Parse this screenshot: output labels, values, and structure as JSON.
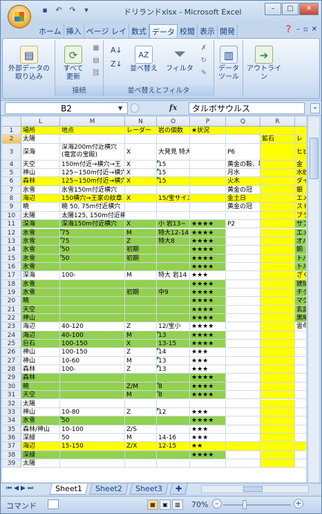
{
  "window": {
    "title": "ドリランドxlsx - Microsoft Excel"
  },
  "tabs": [
    "ホーム",
    "挿入",
    "ページ レイ",
    "数式",
    "データ",
    "校閲",
    "表示",
    "開発"
  ],
  "active_tab": "データ",
  "ribbon": {
    "external_data": "外部データの\n取り込み",
    "refresh_all": "すべて\n更新",
    "connections_group": "接続",
    "sort": "並べ替え",
    "filter": "フィルタ",
    "sort_filter_group": "並べ替えとフィルタ",
    "data_tools": "データ\nツール",
    "outline": "アウトライン"
  },
  "formula_bar": {
    "name_box": "B2",
    "fx": "fx",
    "formula": "タルボサウルス"
  },
  "columns": [
    "L",
    "M",
    "N",
    "O",
    "P",
    "Q",
    "R"
  ],
  "sheets": [
    "Sheet1",
    "Sheet2",
    "Sheet3"
  ],
  "status": {
    "mode": "コマンド",
    "zoom": "70%"
  },
  "rows": [
    {
      "n": "1",
      "L": "場所",
      "M": "地点",
      "N": "レーダー",
      "O": "岩の個数",
      "P": "★状況",
      "Q": "",
      "R": "",
      "S": "",
      "fill": "y"
    },
    {
      "n": "2",
      "L": "太陽",
      "M": "",
      "N": "",
      "O": "",
      "P": "",
      "Q": "",
      "R": "鉱石",
      "S": "レ"
    },
    {
      "n": "3",
      "L": "深海",
      "M": "深海200m付近横穴\n(竜宮の宝殿)",
      "N": "X",
      "O": "大発見 特大 岩16~",
      "P": "",
      "Q": "P6",
      "R": "",
      "S": "ヒビ"
    },
    {
      "n": "4",
      "L": "天空",
      "M": "150m付近→横穴→王",
      "N": "X",
      "O": "15",
      "P": "",
      "Q": "黄金の鞍、靴、耳飾り",
      "R": "",
      "S": "金",
      "tri": [
        "O"
      ]
    },
    {
      "n": "5",
      "L": "神山",
      "M": "125~150m付近→横穴",
      "N": "X",
      "O": "15",
      "P": "",
      "Q": "月水",
      "R": "",
      "S": "水紋",
      "tri": [
        "O"
      ]
    },
    {
      "n": "6",
      "L": "森林",
      "M": "125~150m付近→横穴",
      "N": "X",
      "O": "15",
      "P": "",
      "Q": "火木",
      "R": "",
      "S": "ダイ",
      "fill": "y",
      "tri": [
        "O"
      ]
    },
    {
      "n": "7",
      "L": "氷雪",
      "M": "氷雪150m付近横穴",
      "N": "",
      "O": "",
      "P": "",
      "Q": "黄金の冠",
      "R": "",
      "S": "銀"
    },
    {
      "n": "8",
      "L": "海辺",
      "M": "150横穴→王家の紋章",
      "N": "X",
      "O": "15/宝サイズ極小",
      "P": "",
      "Q": "金土日",
      "R": "",
      "S": "エメ",
      "fill": "y"
    },
    {
      "n": "9",
      "L": "暁",
      "M": "暁 50, 75m付近横穴",
      "N": "",
      "O": "",
      "P": "",
      "Q": "黄金の冠",
      "R": "",
      "S": "スト"
    },
    {
      "n": "10",
      "L": "太陽",
      "M": "太陽125, 150m付近横穴",
      "N": "",
      "O": "",
      "P": "",
      "Q": "",
      "R": "",
      "S": "ブラ"
    },
    {
      "n": "11",
      "L": "深海",
      "M": "深海150m付近横穴",
      "N": "X",
      "O": "小 岩13~",
      "P": "★★★★",
      "Q": "P2",
      "R": "",
      "S": "サフ",
      "fill": "g"
    },
    {
      "n": "12",
      "L": "氷雪",
      "M": "75",
      "N": "M",
      "O": "特大12-14",
      "P": "★★★★",
      "Q": "",
      "R": "",
      "S": "エメ",
      "fill": "g",
      "tri": [
        "M"
      ]
    },
    {
      "n": "13",
      "L": "氷雪",
      "M": "75",
      "N": "Z",
      "O": "特大8",
      "P": "★★★★",
      "Q": "",
      "R": "",
      "S": "オパ",
      "fill": "g",
      "tri": [
        "M"
      ]
    },
    {
      "n": "14",
      "L": "氷雪",
      "M": "50",
      "N": "初期",
      "O": "",
      "P": "★★★★",
      "Q": "",
      "R": "",
      "S": "銅",
      "fill": "g",
      "tri": [
        "M"
      ]
    },
    {
      "n": "15",
      "L": "氷雪",
      "M": "50",
      "N": "初期",
      "O": "",
      "P": "★★★★",
      "Q": "",
      "R": "",
      "S": "トパ",
      "fill": "g",
      "tri": [
        "M"
      ]
    },
    {
      "n": "16",
      "L": "氷雪",
      "M": "",
      "N": "",
      "O": "",
      "P": "★★★★",
      "Q": "",
      "R": "",
      "S": "トル",
      "fill": "g"
    },
    {
      "n": "17",
      "L": "深海",
      "M": "100-",
      "N": "M",
      "O": "特大 岩14",
      "P": "★★★",
      "Q": "",
      "R": "",
      "S": "ざく"
    },
    {
      "n": "18",
      "L": "氷雪",
      "M": "",
      "N": "",
      "O": "",
      "P": "★★★★",
      "Q": "",
      "R": "",
      "S": "琥珀",
      "fill": "g"
    },
    {
      "n": "19",
      "L": "氷雪",
      "M": "",
      "N": "初期",
      "O": "中9",
      "P": "★★★★",
      "Q": "",
      "R": "",
      "S": "チタ",
      "fill": "g"
    },
    {
      "n": "20",
      "L": "暁",
      "M": "",
      "N": "",
      "O": "",
      "P": "★★★★",
      "Q": "",
      "R": "",
      "S": "マグ",
      "fill": "g"
    },
    {
      "n": "21",
      "L": "天空",
      "M": "",
      "N": "",
      "O": "",
      "P": "★★★★",
      "Q": "",
      "R": "",
      "S": "玄武",
      "fill": "g"
    },
    {
      "n": "22",
      "L": "神山",
      "M": "",
      "N": "",
      "O": "",
      "P": "★★★★",
      "Q": "",
      "R": "",
      "S": "黒曜",
      "fill": "g"
    },
    {
      "n": "23",
      "L": "海辺",
      "M": "40-120",
      "N": "Z",
      "O": "12/宝小",
      "P": "★★★★",
      "Q": "",
      "R": "",
      "S": "雲母"
    },
    {
      "n": "24",
      "L": "海辺",
      "M": "40-100",
      "N": "M",
      "O": "13",
      "P": "★★★★",
      "Q": "",
      "R": "",
      "S": "",
      "fill": "g",
      "tri": [
        "O"
      ]
    },
    {
      "n": "25",
      "L": "巨石",
      "M": "100-150",
      "N": "X",
      "O": "13-15",
      "P": "★★★★",
      "Q": "",
      "R": "",
      "S": "",
      "fill": "g"
    },
    {
      "n": "26",
      "L": "神山",
      "M": "100-150",
      "N": "Z",
      "O": "14",
      "P": "★★★",
      "Q": "",
      "R": "",
      "S": "",
      "tri": [
        "O"
      ]
    },
    {
      "n": "27",
      "L": "神山",
      "M": "10-60",
      "N": "M",
      "O": "13",
      "P": "★★★",
      "Q": "",
      "R": "",
      "S": "",
      "tri": [
        "O"
      ]
    },
    {
      "n": "28",
      "L": "森林",
      "M": "100-",
      "N": "Z",
      "O": "13",
      "P": "★★★",
      "Q": "",
      "R": "",
      "S": "",
      "tri": [
        "O"
      ]
    },
    {
      "n": "29",
      "L": "森林",
      "M": "",
      "N": "",
      "O": "",
      "P": "★★★★",
      "Q": "",
      "R": "",
      "S": "",
      "fill": "g"
    },
    {
      "n": "30",
      "L": "暁",
      "M": "",
      "N": "Z/M",
      "O": "8",
      "P": "★★★★",
      "Q": "",
      "R": "",
      "S": "",
      "fill": "g",
      "tri": [
        "O"
      ]
    },
    {
      "n": "31",
      "L": "天空",
      "M": "",
      "N": "M",
      "O": "8",
      "P": "★★★★",
      "Q": "",
      "R": "",
      "S": "",
      "fill": "g",
      "tri": [
        "O"
      ]
    },
    {
      "n": "32",
      "L": "太陽",
      "M": "",
      "N": "",
      "O": "",
      "P": "",
      "Q": "",
      "R": "",
      "S": ""
    },
    {
      "n": "33",
      "L": "神山",
      "M": "10-80",
      "N": "Z",
      "O": "12",
      "P": "★★★",
      "Q": "",
      "R": "",
      "S": "",
      "tri": [
        "O"
      ]
    },
    {
      "n": "34",
      "L": "氷雪",
      "M": "50",
      "N": "",
      "O": "",
      "P": "★★★★",
      "Q": "",
      "R": "",
      "S": "",
      "fill": "g",
      "tri": [
        "M"
      ]
    },
    {
      "n": "35",
      "L": "森林/神山",
      "M": "10-100",
      "N": "Z/S",
      "O": "",
      "P": "★★★",
      "Q": "",
      "R": "",
      "S": ""
    },
    {
      "n": "36",
      "L": "深緑",
      "M": "50",
      "N": "M",
      "O": "14-16",
      "P": "★★★",
      "Q": "",
      "R": "",
      "S": ""
    },
    {
      "n": "37",
      "L": "海辺",
      "M": "15-150",
      "N": "Z/X",
      "O": "12-15",
      "P": "★★",
      "Q": "",
      "R": "",
      "S": "",
      "fill": "y"
    },
    {
      "n": "38",
      "L": "深緑",
      "M": "",
      "N": "",
      "O": "",
      "P": "★★★★",
      "Q": "",
      "R": "",
      "S": "",
      "fill": "g"
    },
    {
      "n": "39",
      "L": "太陽",
      "M": "",
      "N": "",
      "O": "",
      "P": "",
      "Q": "",
      "R": "",
      "S": ""
    }
  ]
}
